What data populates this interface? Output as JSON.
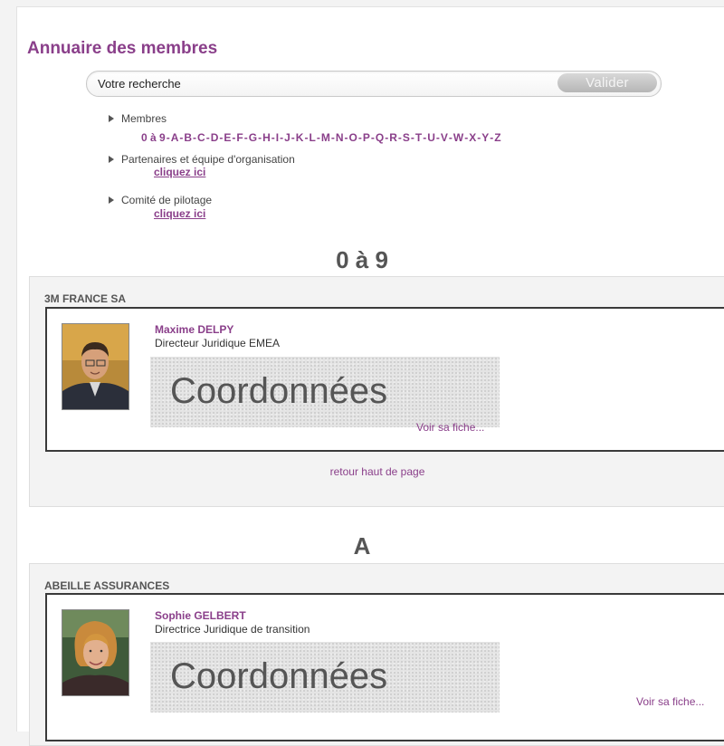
{
  "page": {
    "title": "Annuaire des membres"
  },
  "search": {
    "placeholder": "Votre recherche",
    "value": "",
    "submit_label": "Valider"
  },
  "nav": {
    "members_label": "Membres",
    "letters": [
      "0 à 9",
      "A",
      "B",
      "C",
      "D",
      "E",
      "F",
      "G",
      "H",
      "I",
      "J",
      "K",
      "L",
      "M",
      "N",
      "O",
      "P",
      "Q",
      "R",
      "S",
      "T",
      "U",
      "V",
      "W",
      "X",
      "Y",
      "Z"
    ],
    "partners_label": "Partenaires et équipe d'organisation",
    "partners_link": "cliquez ici",
    "committee_label": "Comité de pilotage",
    "committee_link": "cliquez ici"
  },
  "sections": [
    {
      "heading": "0 à 9",
      "company": "3M FRANCE SA",
      "member_name": "Maxime DELPY",
      "member_role": "Directeur Juridique EMEA",
      "coord_label": "Coordonnées",
      "fiche_link": "Voir sa fiche...",
      "back_link": "retour haut de page"
    },
    {
      "heading": "A",
      "company": "ABEILLE ASSURANCES",
      "member_name": "Sophie GELBERT",
      "member_role": "Directrice Juridique de transition",
      "coord_label": "Coordonnées",
      "fiche_link": "Voir sa fiche..."
    }
  ],
  "colors": {
    "accent": "#8a3f8a",
    "panel_bg": "#f3f3f3",
    "card_border": "#3a3a3a"
  }
}
